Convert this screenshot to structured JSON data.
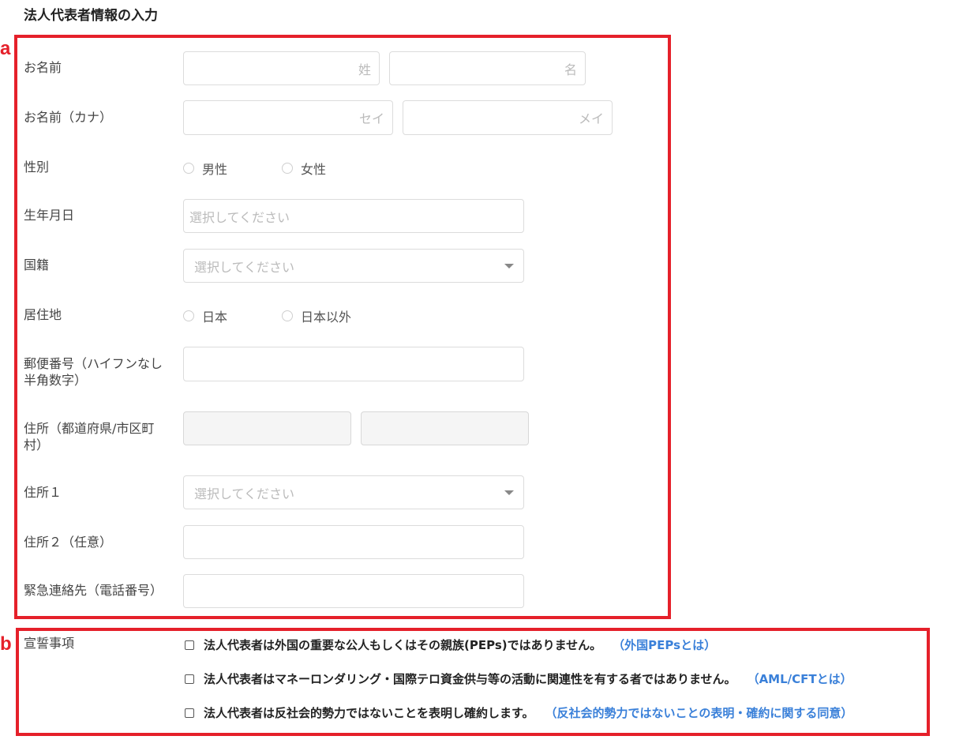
{
  "page_title": "法人代表者情報の入力",
  "markers": {
    "a": "a",
    "b": "b"
  },
  "colors": {
    "frame": "#e5202a",
    "link": "#3a80d9"
  },
  "form": {
    "name": {
      "label": "お名前",
      "last_placeholder": "姓",
      "first_placeholder": "名"
    },
    "name_kana": {
      "label": "お名前（カナ）",
      "last_placeholder": "セイ",
      "first_placeholder": "メイ"
    },
    "gender": {
      "label": "性別",
      "options": [
        "男性",
        "女性"
      ]
    },
    "birthdate": {
      "label": "生年月日",
      "placeholder": "選択してください"
    },
    "nationality": {
      "label": "国籍",
      "placeholder": "選択してください"
    },
    "residence": {
      "label": "居住地",
      "options": [
        "日本",
        "日本以外"
      ]
    },
    "postal_code": {
      "label_line1": "郵便番号（ハイフンなし",
      "label_line2": "半角数字）"
    },
    "address_pref_city": {
      "label_line1": "住所（都道府県/市区町",
      "label_line2": "村）"
    },
    "address1": {
      "label": "住所１",
      "placeholder": "選択してください"
    },
    "address2": {
      "label": "住所２（任意）"
    },
    "emergency_phone": {
      "label": "緊急連絡先（電話番号）"
    }
  },
  "declarations": {
    "label": "宣誓事項",
    "items": [
      {
        "text": "法人代表者は外国の重要な公人もしくはその親族(PEPs)ではありません。",
        "link": "（外国PEPsとは）"
      },
      {
        "text": "法人代表者はマネーロンダリング・国際テロ資金供与等の活動に関連性を有する者ではありません。",
        "link": "（AML/CFTとは）"
      },
      {
        "text": "法人代表者は反社会的勢力ではないことを表明し確約します。",
        "link": "（反社会的勢力ではないことの表明・確約に関する同意）"
      }
    ]
  }
}
